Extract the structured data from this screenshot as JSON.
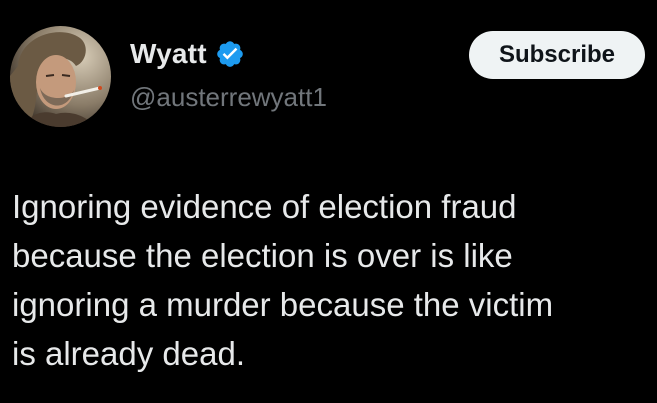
{
  "author": {
    "display_name": "Wyatt",
    "handle": "@austerrewyatt1",
    "verified": true,
    "avatar_icon": "profile-photo"
  },
  "actions": {
    "subscribe_label": "Subscribe"
  },
  "tweet": {
    "text": "Ignoring evidence of election fraud\nbecause the election is over is like\nignoring a murder because the victim\nis already dead."
  },
  "colors": {
    "background": "#000000",
    "text_primary": "#e7e9ea",
    "text_secondary": "#71767b",
    "verified_blue": "#1d9bf0",
    "button_bg": "#eff3f4",
    "button_text": "#0f1419"
  }
}
